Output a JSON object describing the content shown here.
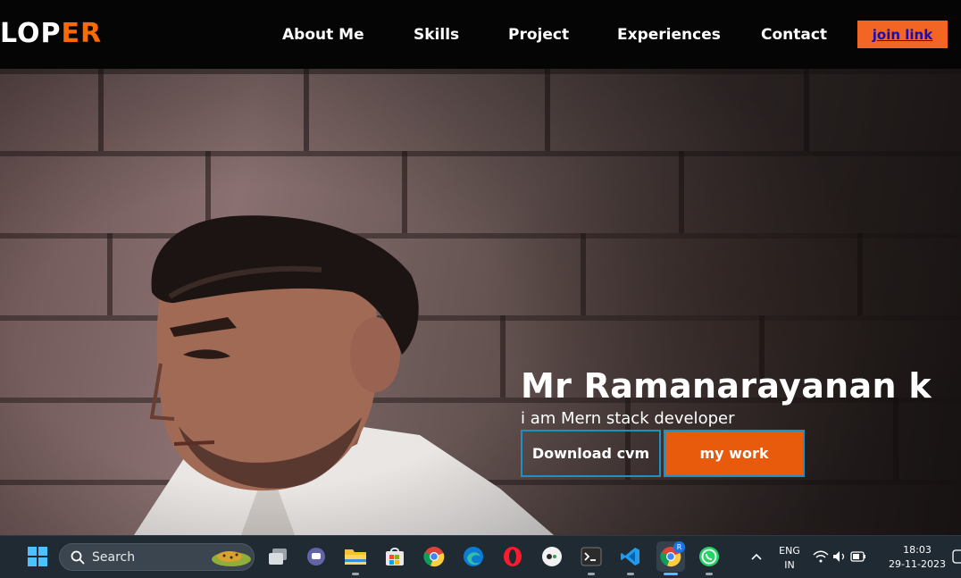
{
  "logo": {
    "text_main": "LOP",
    "text_accent": "ER"
  },
  "nav": {
    "items": [
      {
        "label": "About Me"
      },
      {
        "label": "Skills"
      },
      {
        "label": "Project"
      },
      {
        "label": "Experiences"
      },
      {
        "label": "Contact"
      }
    ],
    "join_label": "join link"
  },
  "hero": {
    "title": "Mr Ramanarayanan k",
    "subtitle": "i am Mern stack developer",
    "download_label": "Download cvm",
    "work_label": "my work"
  },
  "taskbar": {
    "search_placeholder": "Search",
    "language_line1": "ENG",
    "language_line2": "IN",
    "time": "18:03",
    "date": "29-11-2023",
    "chrome_badge": "R"
  },
  "colors": {
    "accent": "#ff6a00",
    "button_orange": "#e85a0c",
    "button_border": "#1e90c8",
    "navbar_bg": "#050505",
    "taskbar_bg": "#1f2a33"
  }
}
